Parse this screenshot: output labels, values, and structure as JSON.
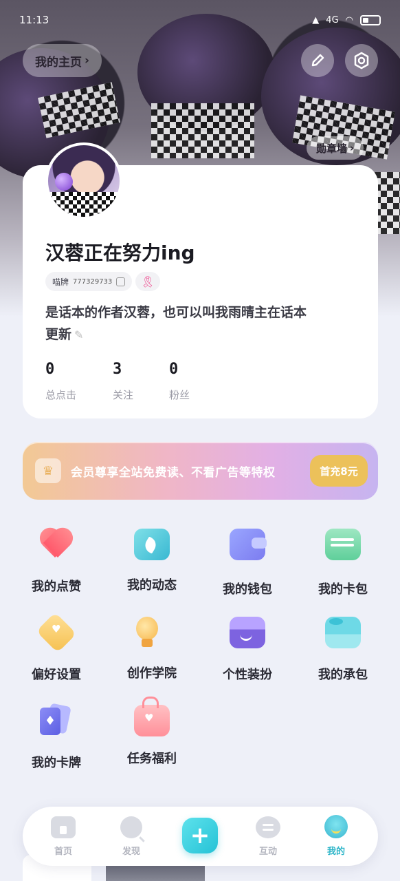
{
  "status_bar": {
    "time": "11:13",
    "network": "4G"
  },
  "header": {
    "homepage_label": "我的主页",
    "badge_wall_label": "勋章墙",
    "icons": [
      "pencil-icon",
      "settings-icon"
    ]
  },
  "profile": {
    "username": "汉蓉正在努力ing",
    "id_label": "喵牌",
    "id_number": "777329733",
    "bio": "是话本的作者汉蓉，也可以叫我雨晴主在话本更新",
    "stats": [
      {
        "value": "0",
        "label": "总点击"
      },
      {
        "value": "3",
        "label": "关注"
      },
      {
        "value": "0",
        "label": "粉丝"
      }
    ]
  },
  "vip": {
    "text": "会员尊享全站免费读、不看广告等特权",
    "button_label": "首充8元"
  },
  "features": [
    {
      "label": "我的点赞",
      "icon": "heart-icon"
    },
    {
      "label": "我的动态",
      "icon": "dynamic-icon"
    },
    {
      "label": "我的钱包",
      "icon": "wallet-icon"
    },
    {
      "label": "我的卡包",
      "icon": "card-bag-icon"
    },
    {
      "label": "偏好设置",
      "icon": "preference-icon"
    },
    {
      "label": "创作学院",
      "icon": "bulb-icon"
    },
    {
      "label": "个性装扮",
      "icon": "shop-icon"
    },
    {
      "label": "我的承包",
      "icon": "whale-icon"
    },
    {
      "label": "我的卡牌",
      "icon": "cards-icon"
    },
    {
      "label": "任务福利",
      "icon": "gift-icon"
    }
  ],
  "bottom_nav": {
    "items": [
      {
        "label": "首页",
        "icon": "home-icon"
      },
      {
        "label": "发现",
        "icon": "discover-icon"
      },
      {
        "label": "互动",
        "icon": "chat-icon"
      },
      {
        "label": "我的",
        "icon": "mine-icon",
        "active": true
      }
    ],
    "add_icon": "plus-icon"
  },
  "colors": {
    "accent": "#2fb6c9",
    "vip_button": "#ecc15a",
    "ribbon": "#ee4b8e"
  }
}
